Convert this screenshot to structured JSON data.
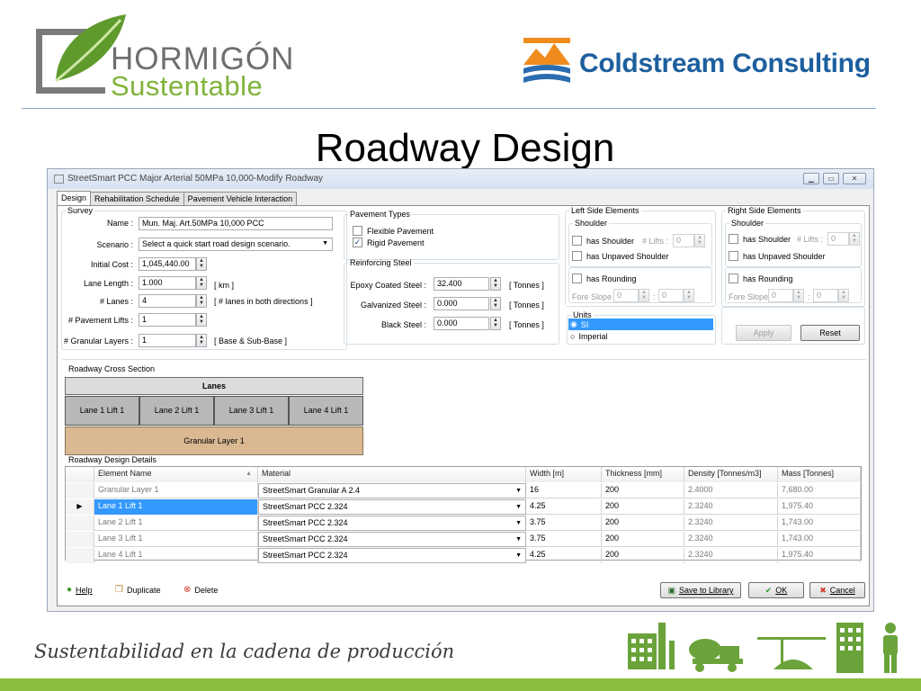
{
  "slide": {
    "logo_left_line1": "HORMIGÓN",
    "logo_left_line2": "Sustentable",
    "logo_right": "Coldstream Consulting",
    "title": "Roadway Design",
    "tagline": "Sustentabilidad en la cadena de producción"
  },
  "window": {
    "title": "StreetSmart PCC Major Arterial 50MPa 10,000-Modify  Roadway",
    "tabs": [
      "Design",
      "Rehabilitation Schedule",
      "Pavement Vehicle Interaction"
    ]
  },
  "survey": {
    "legend": "Survey",
    "name_label": "Name :",
    "name_value": "Mun. Maj. Art.50MPa 10,000 PCC",
    "scenario_label": "Scenario :",
    "scenario_value": "Select a quick start road design scenario.",
    "initial_cost_label": "Initial Cost :",
    "initial_cost_value": "1,045,440.00",
    "lane_length_label": "Lane Length :",
    "lane_length_value": "1.000",
    "lane_length_unit": "[ km ]",
    "lanes_label": "# Lanes :",
    "lanes_value": "4",
    "lanes_unit": "[ # lanes in both directions ]",
    "pavement_lifts_label": "# Pavement Lifts :",
    "pavement_lifts_value": "1",
    "granular_layers_label": "# Granular Layers :",
    "granular_layers_value": "1",
    "granular_layers_unit": "[ Base & Sub-Base ]"
  },
  "pavement_types": {
    "legend": "Pavement Types",
    "flexible_label": "Flexible Pavement",
    "flexible_checked": false,
    "rigid_label": "Rigid Pavement",
    "rigid_checked": true
  },
  "reinforcing_steel": {
    "legend": "Reinforcing Steel",
    "epoxy_label": "Epoxy Coated Steel :",
    "epoxy_value": "32.400",
    "galvanized_label": "Galvanized Steel :",
    "galvanized_value": "0.000",
    "black_label": "Black Steel :",
    "black_value": "0.000",
    "unit": "[ Tonnes ]"
  },
  "left_side": {
    "legend": "Left Side Elements",
    "shoulder_legend": "Shoulder",
    "has_shoulder": "has Shoulder",
    "lifts_label": "# Lifts :",
    "lifts_value": "0",
    "has_unpaved": "has Unpaved Shoulder",
    "has_rounding": "has Rounding",
    "fore_slope_label": "Fore Slope :",
    "fore_slope_a": "0",
    "fore_slope_sep": ":",
    "fore_slope_b": "0"
  },
  "right_side": {
    "legend": "Right Side Elements",
    "shoulder_legend": "Shoulder",
    "has_shoulder": "has Shoulder",
    "lifts_label": "# Lifts :",
    "lifts_value": "0",
    "has_unpaved": "has Unpaved Shoulder",
    "has_rounding": "has Rounding",
    "fore_slope_label": "Fore Slope :",
    "fore_slope_a": "0",
    "fore_slope_sep": ":",
    "fore_slope_b": "0"
  },
  "units": {
    "legend": "Units",
    "si": "SI",
    "imperial": "Imperial",
    "selected": "SI"
  },
  "actions": {
    "apply": "Apply",
    "reset": "Reset"
  },
  "cross_section": {
    "legend": "Roadway Cross Section",
    "lanes_header": "Lanes",
    "lanes": [
      "Lane 1 Lift 1",
      "Lane 2 Lift 1",
      "Lane 3 Lift 1",
      "Lane 4 Lift 1"
    ],
    "granular": "Granular Layer 1"
  },
  "details": {
    "legend": "Roadway Design Details",
    "columns": [
      "Element Name",
      "Material",
      "Width [m]",
      "Thickness [mm]",
      "Density [Tonnes/m3]",
      "Mass [Tonnes]"
    ],
    "rows": [
      {
        "element": "Granular Layer 1",
        "material": "StreetSmart Granular A 2.4",
        "width": "16",
        "thickness": "200",
        "density": "2.4000",
        "mass": "7,680.00"
      },
      {
        "element": "Lane 1 Lift 1",
        "material": "StreetSmart PCC 2.324",
        "width": "4.25",
        "thickness": "200",
        "density": "2.3240",
        "mass": "1,975.40"
      },
      {
        "element": "Lane 2 Lift 1",
        "material": "StreetSmart PCC 2.324",
        "width": "3.75",
        "thickness": "200",
        "density": "2.3240",
        "mass": "1,743.00"
      },
      {
        "element": "Lane 3 Lift 1",
        "material": "StreetSmart PCC 2.324",
        "width": "3.75",
        "thickness": "200",
        "density": "2.3240",
        "mass": "1,743.00"
      },
      {
        "element": "Lane 4 Lift 1",
        "material": "StreetSmart PCC 2.324",
        "width": "4.25",
        "thickness": "200",
        "density": "2.3240",
        "mass": "1,975.40"
      }
    ],
    "selected_row": 1
  },
  "footer": {
    "help": "Help",
    "duplicate": "Duplicate",
    "delete": "Delete",
    "save_library": "Save to Library",
    "ok": "OK",
    "cancel": "Cancel"
  },
  "colors": {
    "accent_green": "#8cbd3f",
    "brand_blue": "#1d5f9e",
    "selection": "#3399ff",
    "granular": "#d9b892"
  }
}
